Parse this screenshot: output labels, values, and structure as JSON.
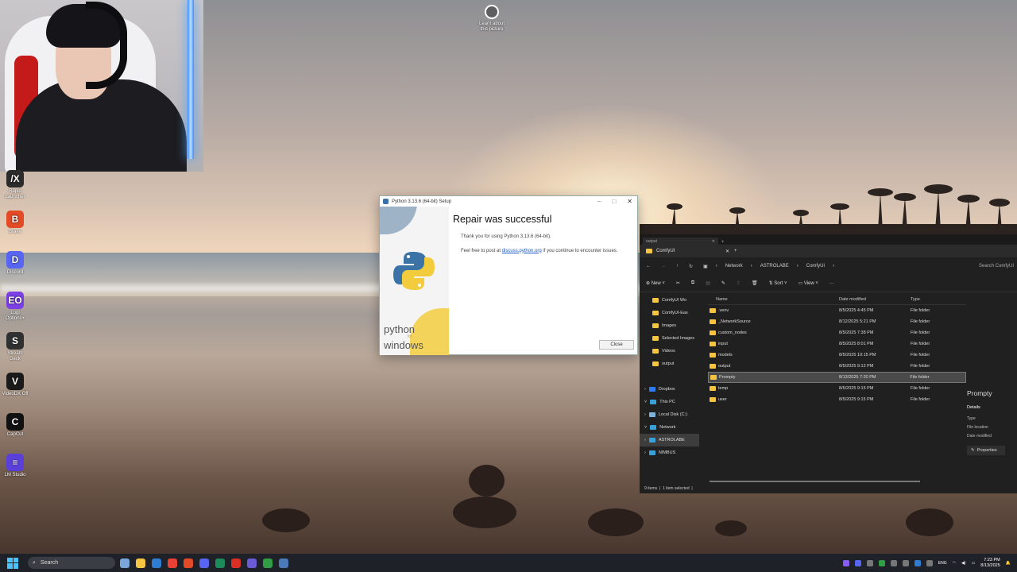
{
  "desktop": {
    "top_icon": "Learn about this picture",
    "icons": [
      {
        "label": "Rapid Launcher",
        "icon": "rapid-launcher-icon",
        "color": "#2b2b2b",
        "glyph": "/X"
      },
      {
        "label": "Brave",
        "icon": "brave-icon",
        "color": "#e24b26",
        "glyph": "B"
      },
      {
        "label": "Discord",
        "icon": "discord-icon",
        "color": "#5865f2",
        "glyph": "D"
      },
      {
        "label": "Logi Options+",
        "icon": "logi-options-icon",
        "color": "#7b3fe4",
        "glyph": "EO"
      },
      {
        "label": "Stream Deck",
        "icon": "stream-deck-icon",
        "color": "#303030",
        "glyph": "S"
      },
      {
        "label": "VideoDX Off",
        "icon": "videodx-icon",
        "color": "#1a1a1a",
        "glyph": "V"
      },
      {
        "label": "CapCut",
        "icon": "capcut-icon",
        "color": "#111111",
        "glyph": "C"
      },
      {
        "label": "LM Studio",
        "icon": "lm-studio-icon",
        "color": "#5a3fd8",
        "glyph": "≡"
      }
    ]
  },
  "python_dialog": {
    "title": "Python 3.13.6 (64-bit) Setup",
    "heading": "Repair was successful",
    "thanks": "Thank you for using Python 3.13.6 (64-bit).",
    "feel_free_prefix": "Feel free to post at ",
    "link": "discuss.python.org",
    "feel_free_suffix": " if you continue to encounter issues.",
    "brand_python": "python",
    "brand_for": "for",
    "brand_windows": "windows",
    "close_label": "Close"
  },
  "explorer": {
    "back_tab": "output",
    "tab_label": "ComfyUI",
    "breadcrumbs": [
      "Network",
      "ASTROLABE",
      "ComfyUI"
    ],
    "search_placeholder": "Search ComfyUI",
    "toolbar": {
      "new": "New",
      "sort": "Sort",
      "view": "View"
    },
    "nav_items": [
      {
        "label": "ComfyUI Wo",
        "kind": "folder"
      },
      {
        "label": "ComfyUI-Eas",
        "kind": "folder"
      },
      {
        "label": "Images",
        "kind": "folder"
      },
      {
        "label": "Selected Images",
        "kind": "folder"
      },
      {
        "label": "Videos",
        "kind": "folder"
      },
      {
        "label": "output",
        "kind": "folder"
      },
      {
        "label": "",
        "kind": "spacer"
      },
      {
        "label": "Dropbox",
        "kind": "cloud"
      },
      {
        "label": "This PC",
        "kind": "pc"
      },
      {
        "label": "Local Disk (C:)",
        "kind": "disk"
      },
      {
        "label": "Network",
        "kind": "network"
      },
      {
        "label": "ASTROLABE",
        "kind": "pc",
        "selected": true
      },
      {
        "label": "NIMBUS",
        "kind": "pc"
      }
    ],
    "columns": [
      "Name",
      "Date modified",
      "Type"
    ],
    "files": [
      {
        "name": ".venv",
        "date": "8/5/2025 4:45 PM",
        "type": "File folder"
      },
      {
        "name": "_NetworkSource",
        "date": "8/12/2025 5:21 PM",
        "type": "File folder"
      },
      {
        "name": "custom_nodes",
        "date": "8/5/2025 7:38 PM",
        "type": "File folder"
      },
      {
        "name": "input",
        "date": "8/5/2025 8:01 PM",
        "type": "File folder"
      },
      {
        "name": "models",
        "date": "8/5/2025 10:15 PM",
        "type": "File folder"
      },
      {
        "name": "output",
        "date": "8/5/2025 9:12 PM",
        "type": "File folder"
      },
      {
        "name": "Prompty",
        "date": "8/13/2025 7:20 PM",
        "type": "File folder",
        "selected": true
      },
      {
        "name": "temp",
        "date": "8/5/2025 9:15 PM",
        "type": "File folder"
      },
      {
        "name": "user",
        "date": "8/5/2025 9:15 PM",
        "type": "File folder"
      }
    ],
    "details": {
      "title": "Prompty",
      "section": "Details",
      "fields": [
        "Type",
        "File location",
        "Date modified"
      ],
      "properties": "Properties"
    },
    "status": {
      "count": "9 items",
      "selected": "1 item selected"
    }
  },
  "taskbar": {
    "search": "Search",
    "language": "ENG",
    "time": "7:23 PM",
    "date": "8/13/2025",
    "app_colors": [
      "#7aa6d9",
      "#f5c542",
      "#2e7dd1",
      "#e94235",
      "#e24b26",
      "#5865f2",
      "#1c8a5b",
      "#d93025",
      "#6b5bd6",
      "#2f9e44",
      "#4a7ab8"
    ]
  }
}
